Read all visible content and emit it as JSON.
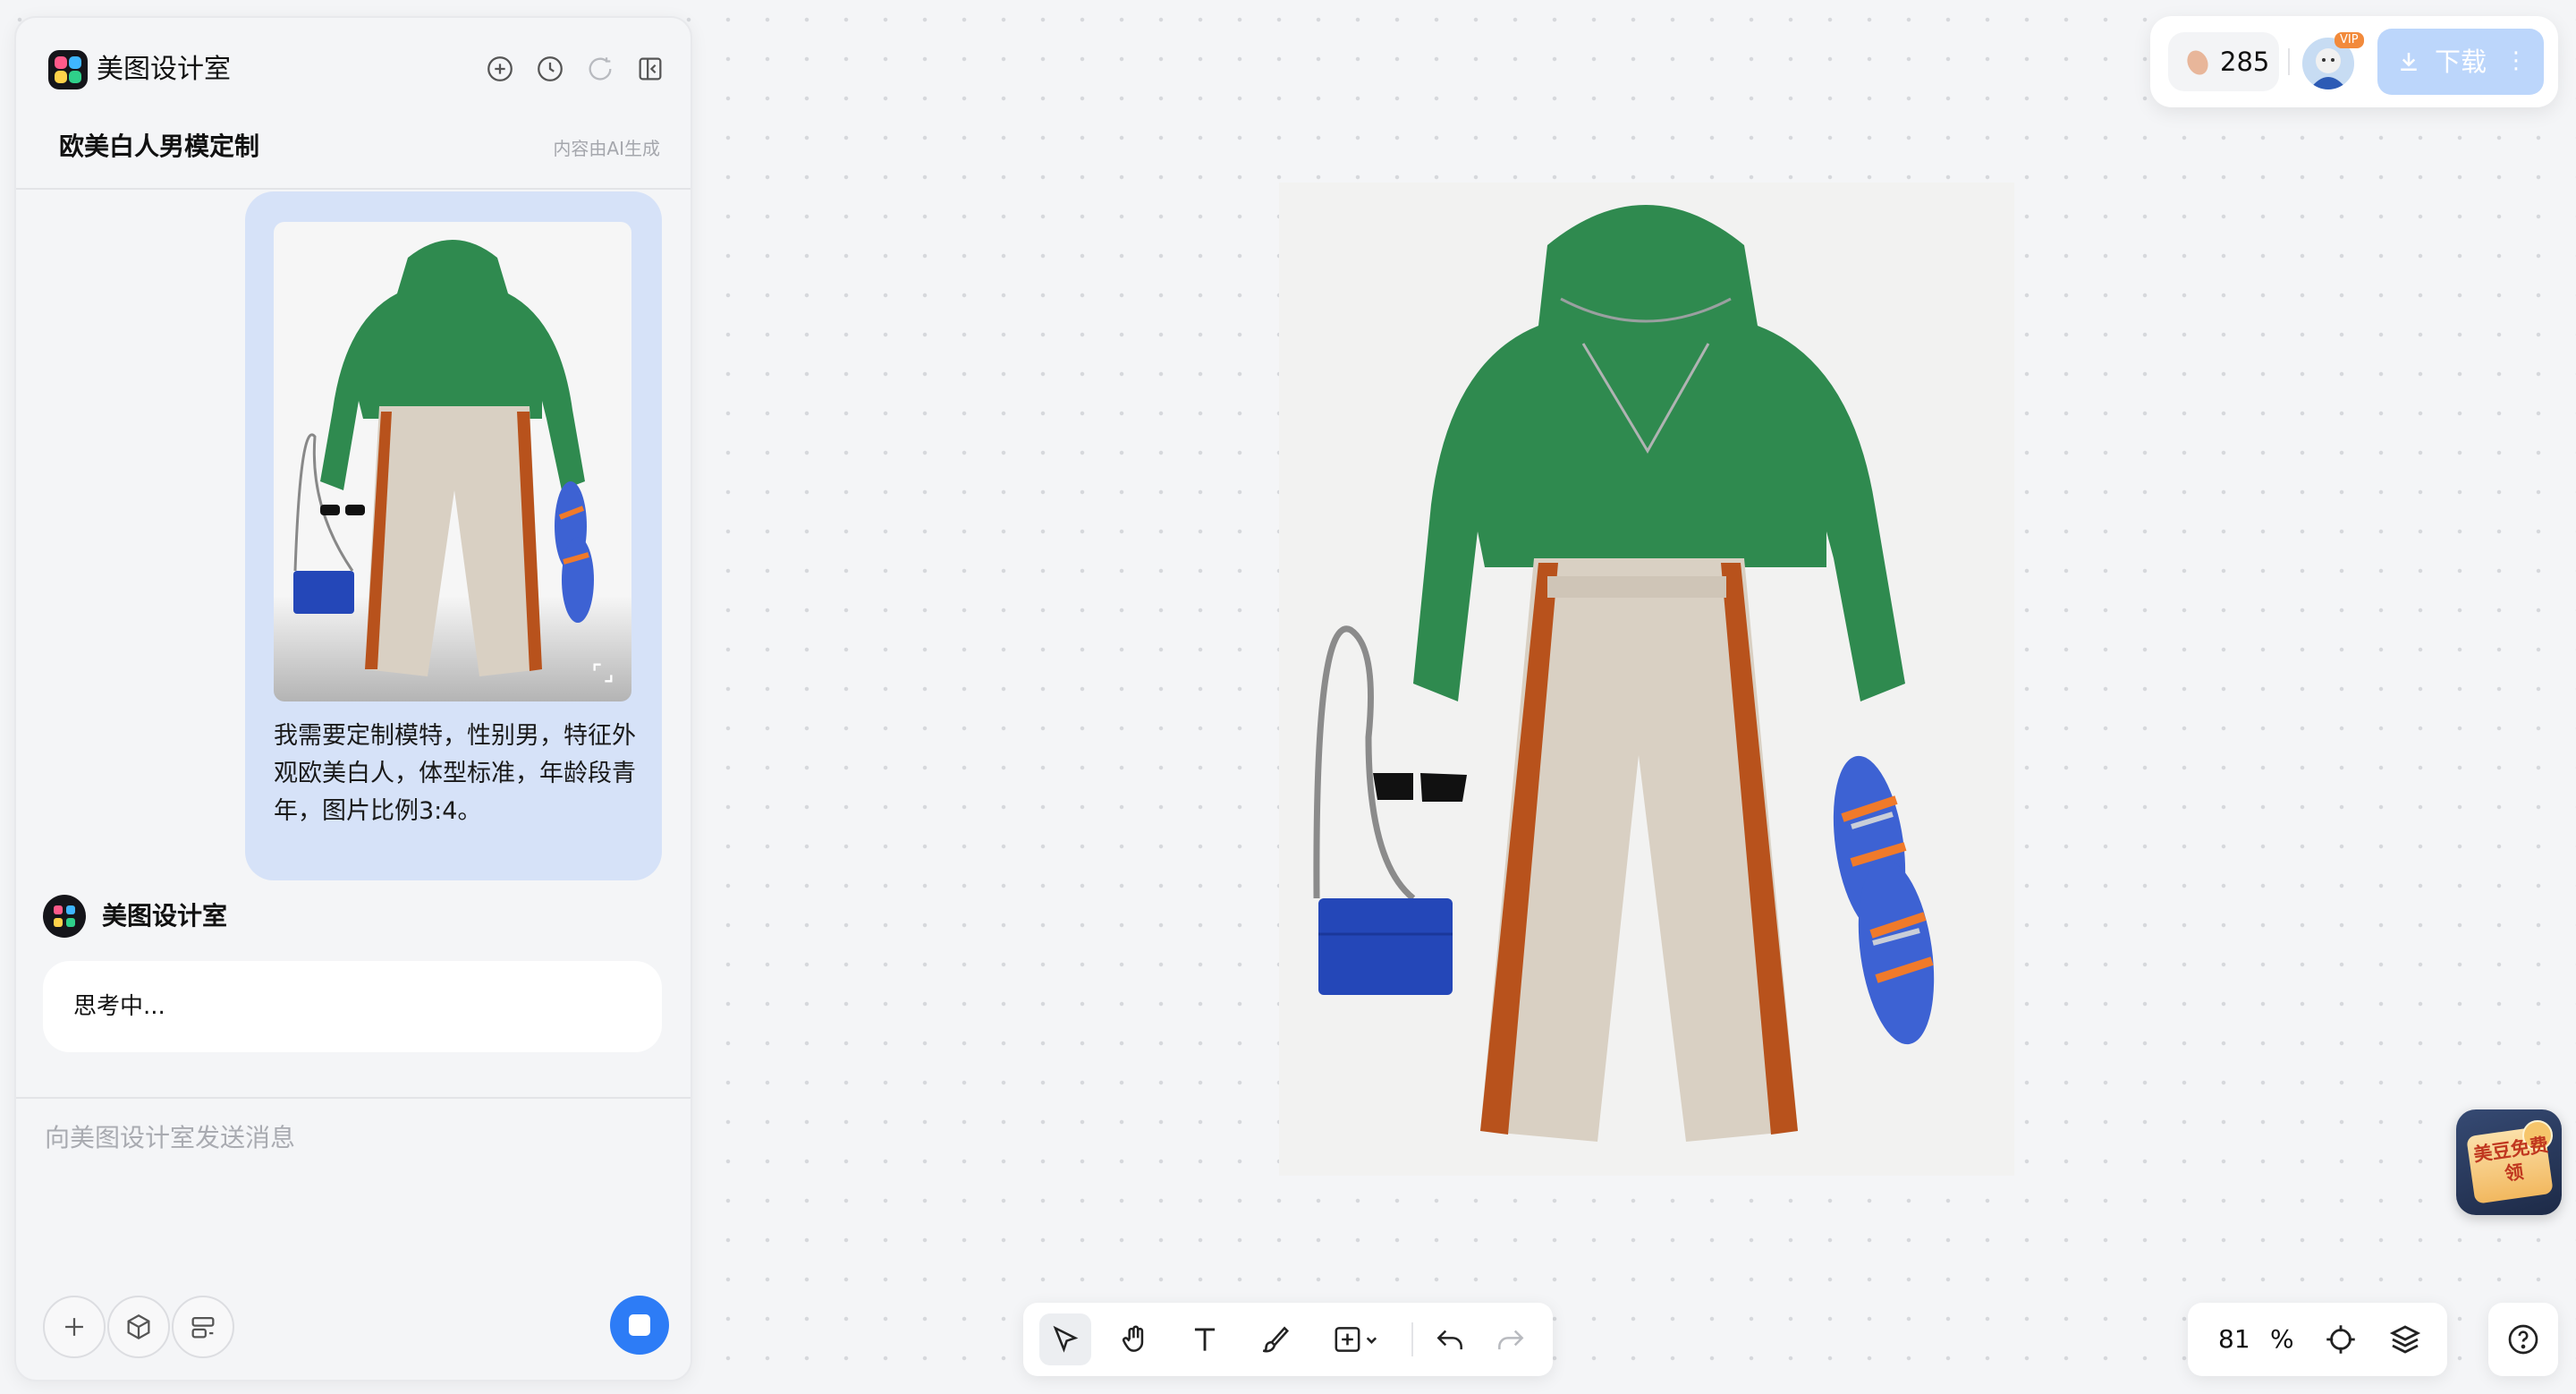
{
  "app": {
    "name": "美图设计室"
  },
  "conversation": {
    "title": "欧美白人男模定制",
    "ai_note": "内容由AI生成"
  },
  "user_message": {
    "text": "我需要定制模特，性别男，特征外观欧美白人，体型标准，年龄段青年，图片比例3:4。"
  },
  "bot": {
    "name": "美图设计室",
    "status": "思考中..."
  },
  "input": {
    "placeholder": "向美图设计室发送消息"
  },
  "topbar": {
    "credits": "285",
    "vip_badge": "VIP",
    "download_label": "下载"
  },
  "zoom": {
    "value": "81",
    "unit": "%"
  },
  "promo": {
    "text": "美豆免费领"
  },
  "colors": {
    "accent": "#2d7cf6",
    "download_disabled": "#bcd6fb",
    "bubble": "#d6e2f8"
  }
}
